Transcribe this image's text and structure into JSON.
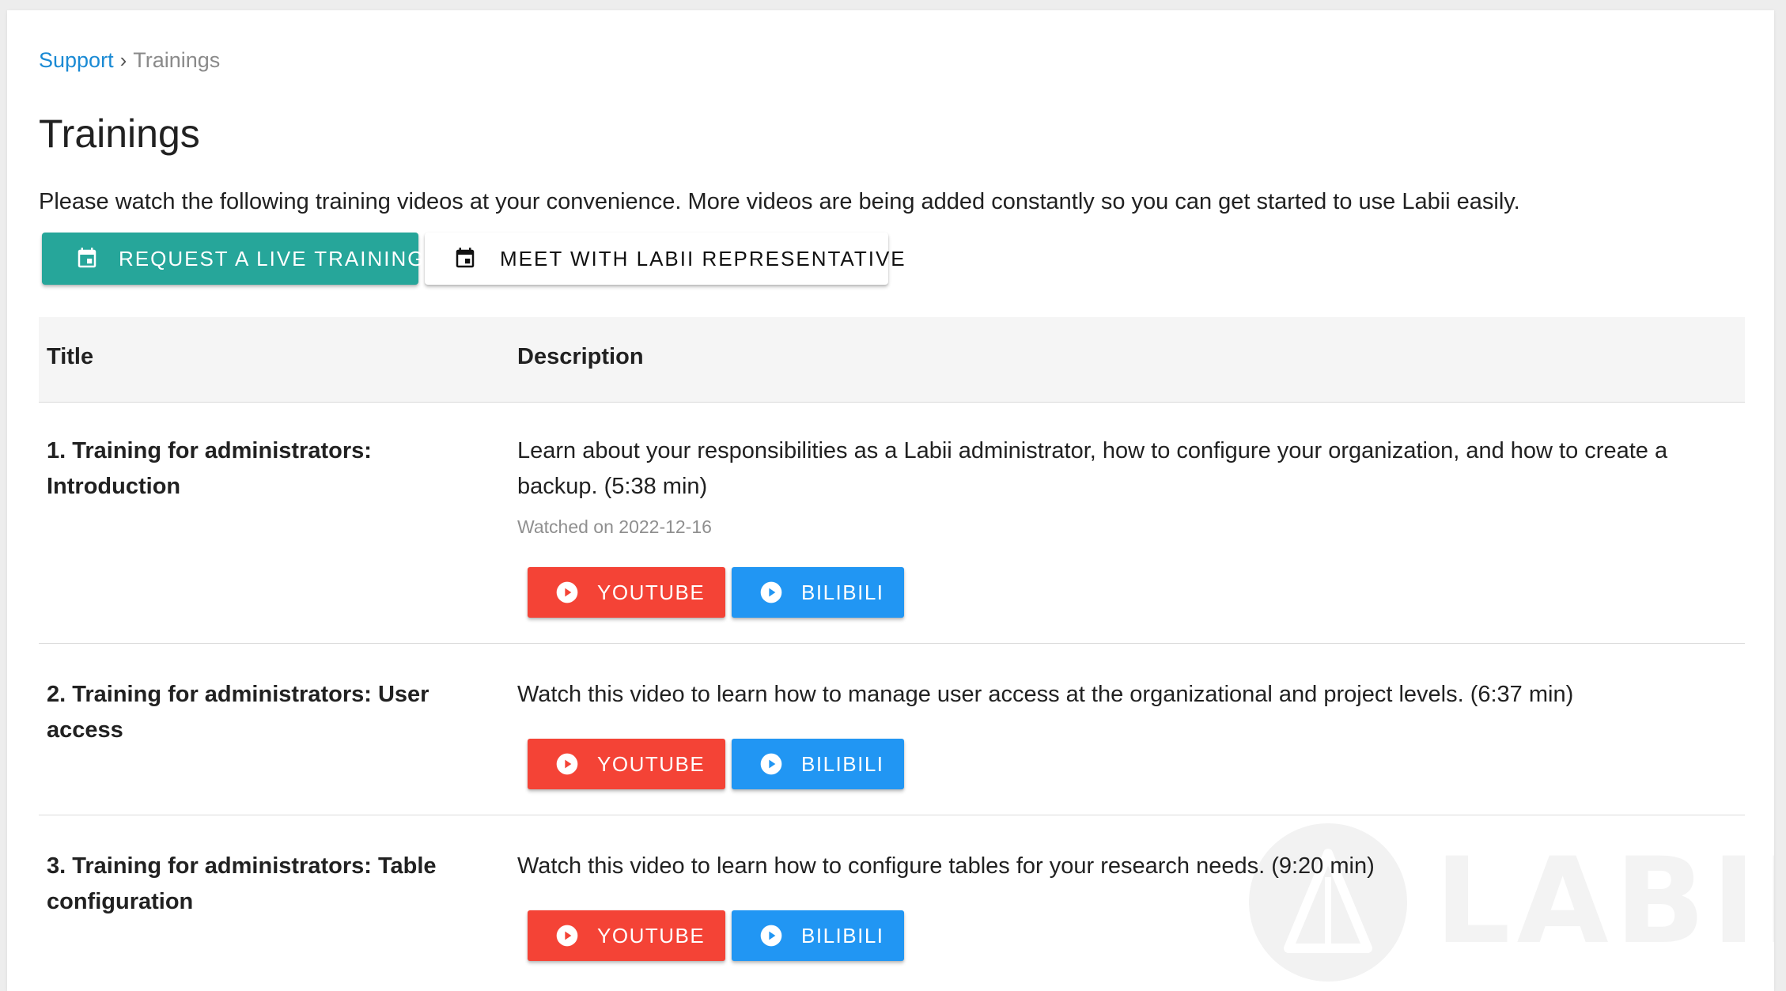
{
  "breadcrumb": {
    "parent": "Support",
    "separator": "›",
    "current": "Trainings"
  },
  "page": {
    "title": "Trainings",
    "intro": "Please watch the following training videos at your convenience. More videos are being added constantly so you can get started to use Labii easily."
  },
  "actions": {
    "request_live_training": "REQUEST A LIVE TRAINING",
    "meet_representative": "MEET WITH LABII REPRESENTATIVE"
  },
  "table": {
    "headers": {
      "title": "Title",
      "description": "Description"
    },
    "rows": [
      {
        "title": "1. Training for administrators: Introduction",
        "description": "Learn about your responsibilities as a Labii administrator, how to configure your organization, and how to create a backup. (5:38 min)",
        "watched": "Watched on 2022-12-16",
        "youtube_label": "YOUTUBE",
        "bilibili_label": "BILIBILI"
      },
      {
        "title": "2. Training for administrators: User access",
        "description": "Watch this video to learn how to manage user access at the organizational and project levels. (6:37 min)",
        "youtube_label": "YOUTUBE",
        "bilibili_label": "BILIBILI"
      },
      {
        "title": "3. Training for administrators: Table configuration",
        "description": "Watch this video to learn how to configure tables for your research needs. (9:20 min)",
        "youtube_label": "YOUTUBE",
        "bilibili_label": "BILIBILI"
      }
    ]
  },
  "watermark": {
    "text": "LABII"
  },
  "colors": {
    "link": "#1a8ad4",
    "primary": "#26a69a",
    "youtube": "#f44336",
    "bilibili": "#2196f3",
    "header_bg": "#f5f5f5",
    "muted": "#8f8f8f"
  },
  "icons": {
    "calendar": "calendar-icon",
    "play": "play-circle-icon"
  }
}
